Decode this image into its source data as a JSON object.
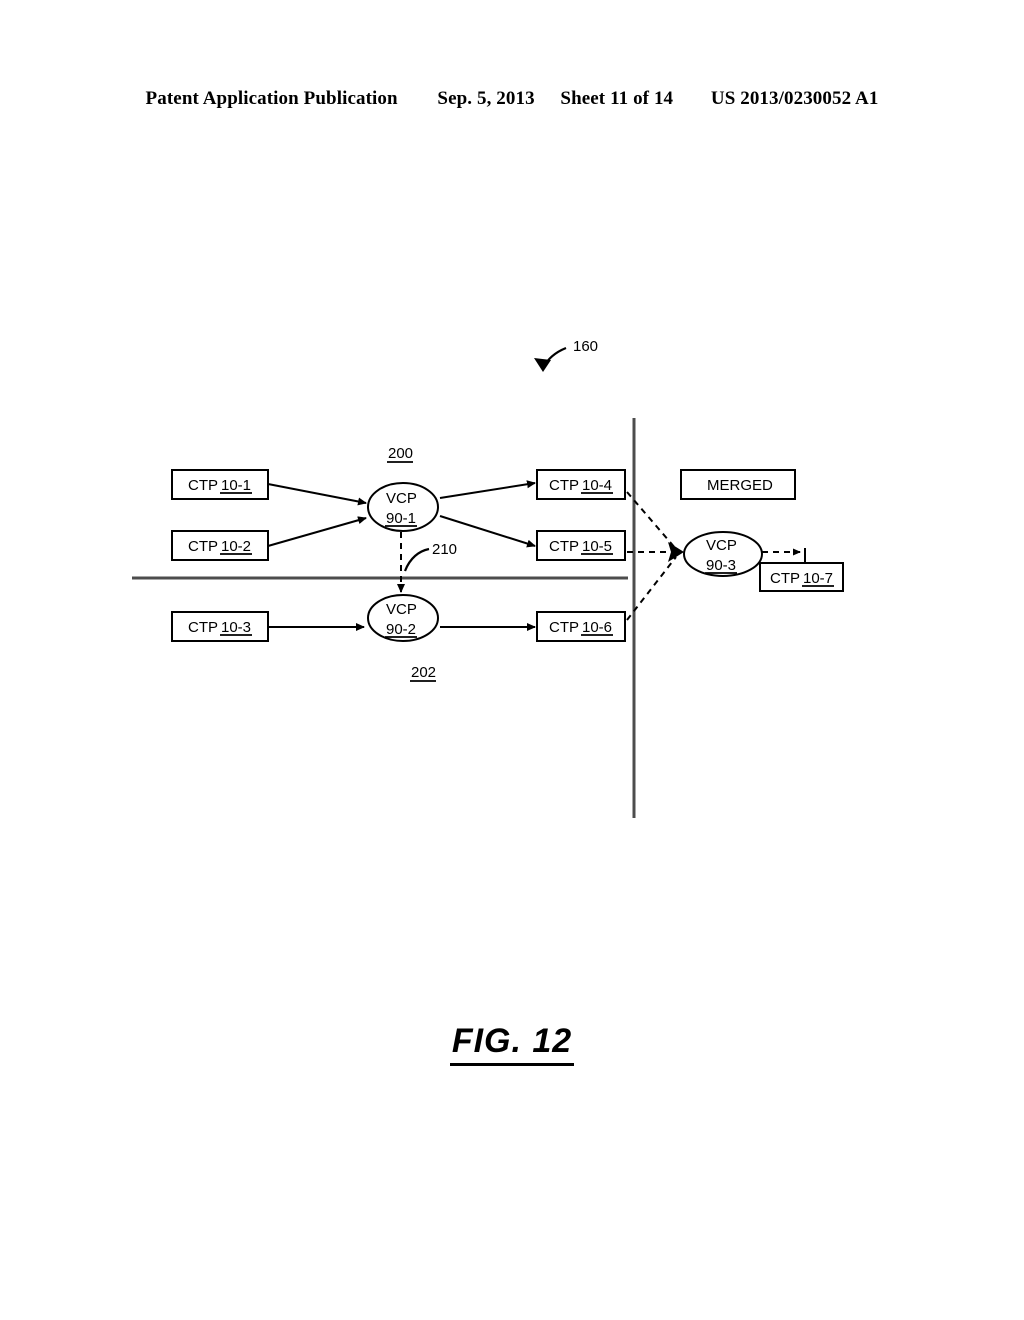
{
  "header": {
    "publication": "Patent Application Publication",
    "date": "Sep. 5, 2013",
    "sheet": "Sheet 11 of 14",
    "pub_number": "US 2013/0230052 A1"
  },
  "figure": {
    "caption": "FIG. 12",
    "figure_reference": "160",
    "group_upper_ref": "200",
    "group_lower_ref": "202",
    "link_ref": "210",
    "merged_label": "MERGED",
    "nodes": {
      "ctp_10_1": {
        "prefix": "CTP",
        "id": "10-1"
      },
      "ctp_10_2": {
        "prefix": "CTP",
        "id": "10-2"
      },
      "ctp_10_3": {
        "prefix": "CTP",
        "id": "10-3"
      },
      "ctp_10_4": {
        "prefix": "CTP",
        "id": "10-4"
      },
      "ctp_10_5": {
        "prefix": "CTP",
        "id": "10-5"
      },
      "ctp_10_6": {
        "prefix": "CTP",
        "id": "10-6"
      },
      "ctp_10_7": {
        "prefix": "CTP",
        "id": "10-7"
      },
      "vcp_90_1": {
        "prefix": "VCP",
        "id": "90-1"
      },
      "vcp_90_2": {
        "prefix": "VCP",
        "id": "90-2"
      },
      "vcp_90_3": {
        "prefix": "VCP",
        "id": "90-3"
      }
    }
  }
}
